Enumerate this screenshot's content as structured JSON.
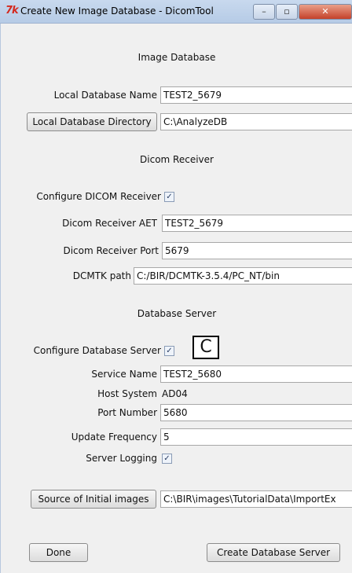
{
  "window": {
    "title": "Create New Image Database - DicomTool",
    "logo": "7k",
    "minimize": "–",
    "maximize": "▫",
    "close": "✕"
  },
  "image_db": {
    "heading": "Image Database",
    "name_label": "Local Database Name",
    "name_value": "TEST2_5679",
    "dir_button": "Local Database Directory",
    "dir_value": "C:\\AnalyzeDB"
  },
  "receiver": {
    "heading": "Dicom Receiver",
    "configure_label": "Configure DICOM Receiver",
    "configure_checked": "✓",
    "aet_label": "Dicom Receiver AET",
    "aet_value": "TEST2_5679",
    "port_label": "Dicom Receiver Port",
    "port_value": "5679",
    "dcmtk_label": "DCMTK path",
    "dcmtk_value": "C:/BIR/DCMTK-3.5.4/PC_NT/bin"
  },
  "server": {
    "heading": "Database Server",
    "configure_label": "Configure Database Server",
    "configure_checked": "✓",
    "marker": "C",
    "service_label": "Service Name",
    "service_value": "TEST2_5680",
    "host_label": "Host System",
    "host_value": "AD04",
    "port_label": "Port Number",
    "port_value": "5680",
    "freq_label": "Update Frequency",
    "freq_value": "5",
    "logging_label": "Server Logging",
    "logging_checked": "✓"
  },
  "source": {
    "button": "Source of Initial images",
    "value": "C:\\BIR\\images\\TutorialData\\ImportEx"
  },
  "actions": {
    "done": "Done",
    "create": "Create Database Server"
  }
}
